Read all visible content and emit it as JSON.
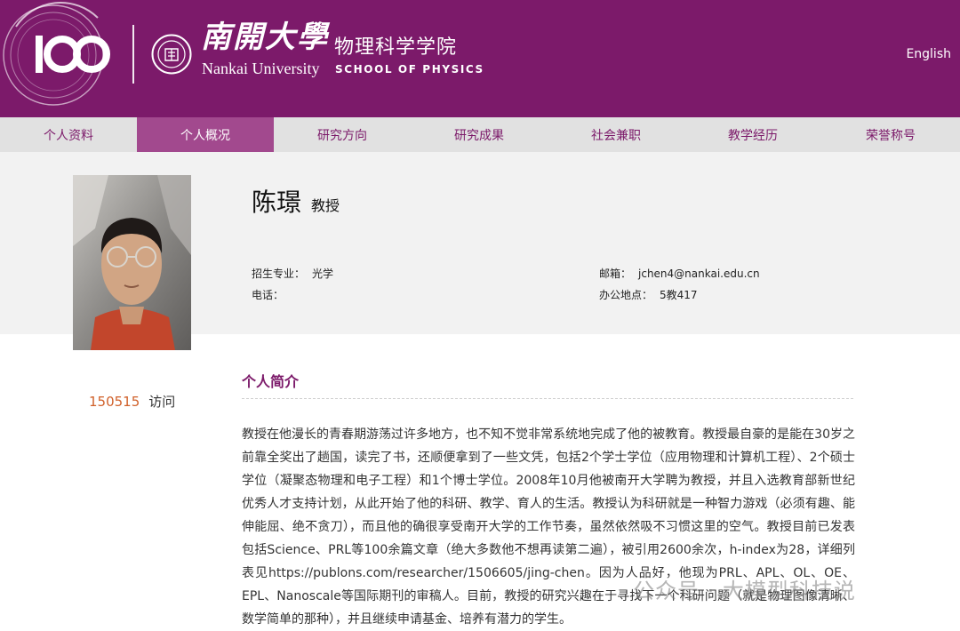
{
  "header": {
    "university_cn": "南開大學",
    "university_en": "Nankai University",
    "school_cn": "物理科学学院",
    "school_en": "SCHOOL OF PHYSICS",
    "language_link": "English",
    "brand_color": "#7c1a6a"
  },
  "nav": {
    "items": [
      "个人资料",
      "个人概况",
      "研究方向",
      "研究成果",
      "社会兼职",
      "教学经历",
      "荣誉称号"
    ],
    "active_index": 1
  },
  "profile": {
    "name": "陈璟",
    "title": "教授",
    "major_label": "招生专业：",
    "major_value": "光学",
    "phone_label": "电话：",
    "phone_value": "",
    "email_label": "邮箱：",
    "email_value": "jchen4@nankai.edu.cn",
    "office_label": "办公地点：",
    "office_value": "5教417"
  },
  "stats": {
    "visits_count": "150515",
    "visits_label": "访问"
  },
  "bio": {
    "heading": "个人简介",
    "text": "教授在他漫长的青春期游荡过许多地方，也不知不觉非常系统地完成了他的被教育。教授最自豪的是能在30岁之前靠全奖出了趟国，读完了书，还顺便拿到了一些文凭，包括2个学士学位（应用物理和计算机工程）、2个硕士学位（凝聚态物理和电子工程）和1个博士学位。2008年10月他被南开大学聘为教授，并且入选教育部新世纪优秀人才支持计划，从此开始了他的科研、教学、育人的生活。教授认为科研就是一种智力游戏（必须有趣、能伸能屈、绝不贪刀），而且他的确很享受南开大学的工作节奏，虽然依然吸不习惯这里的空气。教授目前已发表包括Science、PRL等100余篇文章（绝大多数他不想再读第二遍），被引用2600余次，h-index为28，详细列表见https://publons.com/researcher/1506605/jing-chen。因为人品好，他现为PRL、APL、OL、OE、EPL、Nanoscale等国际期刊的审稿人。目前，教授的研究兴趣在于寻找下一个科研问题（就是物理图像清晰、数学简单的那种），并且继续申请基金、培养有潜力的学生。"
  },
  "watermark": {
    "text": "公众号 · 大模型科技说"
  }
}
